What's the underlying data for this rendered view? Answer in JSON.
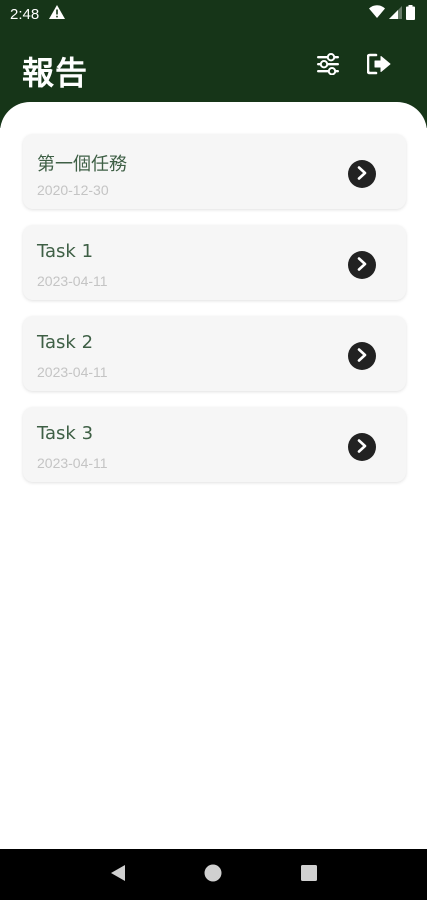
{
  "status_bar": {
    "time": "2:48",
    "icons": [
      "warning-icon",
      "wifi-icon",
      "signal-icon",
      "battery-icon"
    ]
  },
  "header": {
    "title": "報告",
    "actions": [
      "filter-sliders-icon",
      "logout-icon"
    ]
  },
  "tasks": [
    {
      "title": "第一個任務",
      "date": "2020-12-30"
    },
    {
      "title": "Task 1",
      "date": "2023-04-11"
    },
    {
      "title": "Task 2",
      "date": "2023-04-11"
    },
    {
      "title": "Task 3",
      "date": "2023-04-11"
    }
  ],
  "nav_bar": {
    "buttons": [
      "back-icon",
      "home-icon",
      "recents-icon"
    ]
  },
  "colors": {
    "header_bg": "#163518",
    "card_bg": "#f6f6f6",
    "title_text": "#3e5f45",
    "date_text": "#c4c4c4",
    "arrow_button": "#222222"
  }
}
